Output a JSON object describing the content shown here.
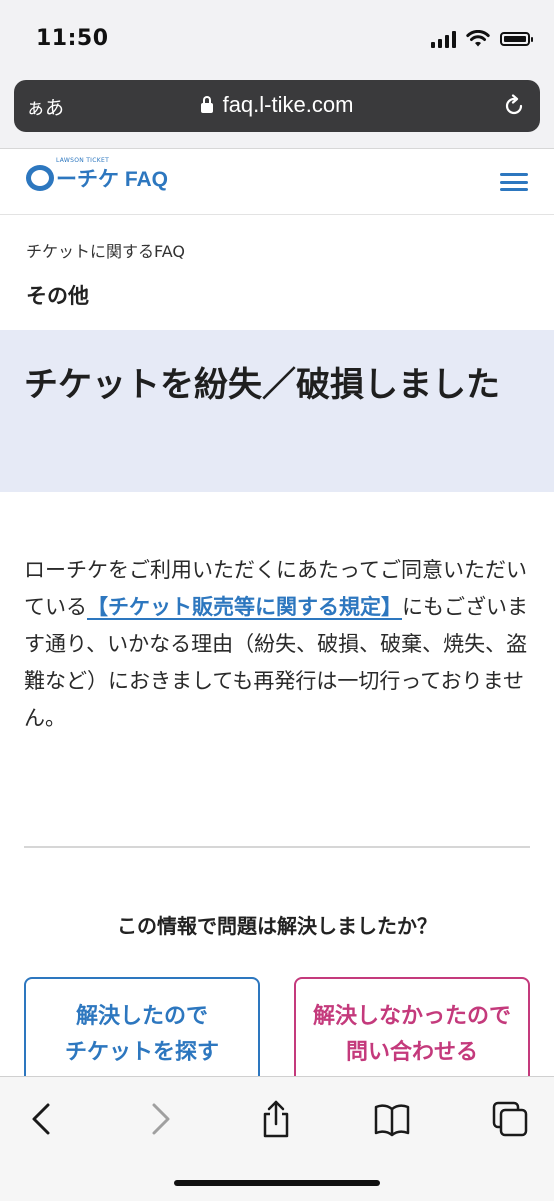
{
  "status_bar": {
    "time": "11:50"
  },
  "browser": {
    "text_size_label": "ぁあ",
    "url": "faq.l-tike.com"
  },
  "site": {
    "logo_small": "LAWSON TICKET",
    "logo_text": "ーチケ FAQ"
  },
  "breadcrumb": "チケットに関するFAQ",
  "category": "その他",
  "title": "チケットを紛失／破損しました",
  "answer": {
    "part1": "ローチケをご利用いただくにあたってご同意いただいている",
    "link": "【チケット販売等に関する規定】",
    "part2": "にもございます通り、いかなる理由（紛失、破損、破棄、焼失、盗難など）におきましても再発行は一切行っておりません。"
  },
  "feedback": {
    "question": "この情報で問題は解決しましたか？",
    "resolved_line1": "解決したので",
    "resolved_line2": "チケットを探す",
    "unresolved_line1": "解決しなかったので",
    "unresolved_line2": "問い合わせる"
  },
  "colors": {
    "brand_blue": "#2d77bf",
    "accent_pink": "#c43a7c",
    "title_band": "#e6eaf6"
  },
  "toolbar_icons": [
    "back-icon",
    "forward-icon",
    "share-icon",
    "bookmarks-icon",
    "tabs-icon"
  ]
}
